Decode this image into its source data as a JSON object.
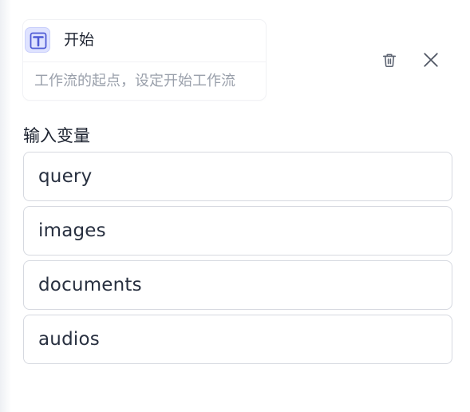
{
  "node": {
    "title": "开始",
    "description": "工作流的起点，设定开始工作流",
    "icon": "text-t-icon",
    "accent": "#4f5bd5"
  },
  "actions": {
    "delete_icon": "trash-icon",
    "close_icon": "close-icon"
  },
  "inputs_section": {
    "label": "输入变量",
    "variables": [
      {
        "name": "query"
      },
      {
        "name": "images"
      },
      {
        "name": "documents"
      },
      {
        "name": "audios"
      }
    ]
  }
}
